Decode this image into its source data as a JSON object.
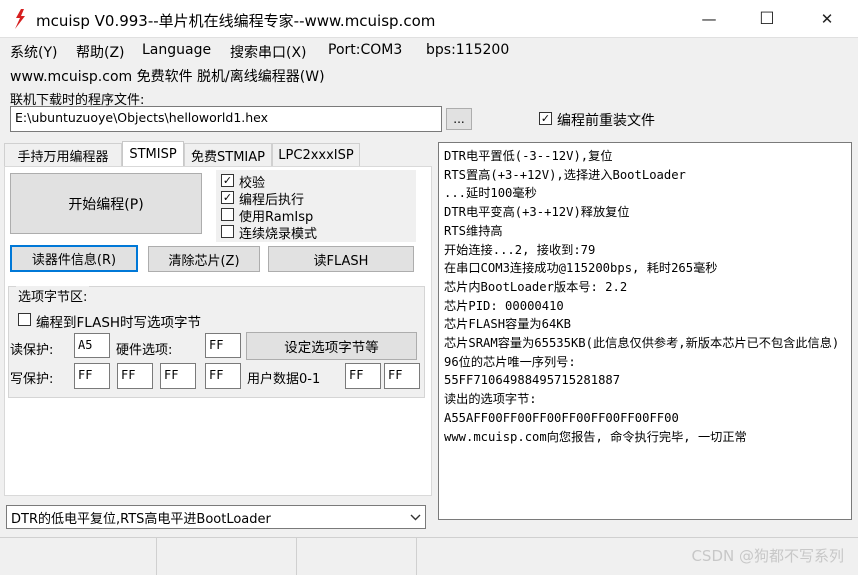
{
  "window": {
    "title": "mcuisp V0.993--单片机在线编程专家--www.mcuisp.com",
    "minimize": "—",
    "maximize": "☐",
    "close": "✕"
  },
  "menu": {
    "items": [
      "系统(Y)",
      "帮助(Z)",
      "Language",
      "搜索串口(X)",
      "Port:COM3",
      "bps:115200"
    ],
    "second_row": "www.mcuisp.com 免费软件 脱机/离线编程器(W)"
  },
  "file": {
    "label": "联机下载时的程序文件:",
    "path": "E:\\ubuntuzuoye\\Objects\\helloworld1.hex",
    "browse": "...",
    "reload_label": "编程前重装文件",
    "reload_checked": true
  },
  "tabs": [
    {
      "label": "手持万用编程器",
      "active": false
    },
    {
      "label": "STMISP",
      "active": true
    },
    {
      "label": "免费STMIAP",
      "active": false
    },
    {
      "label": "LPC2xxxISP",
      "active": false
    }
  ],
  "stmisp": {
    "start_button": "开始编程(P)",
    "options": [
      {
        "label": "校验",
        "checked": true
      },
      {
        "label": "编程后执行",
        "checked": true
      },
      {
        "label": "使用RamIsp",
        "checked": false
      },
      {
        "label": "连续烧录模式",
        "checked": false
      }
    ],
    "read_info_button": "读器件信息(R)",
    "erase_button": "清除芯片(Z)",
    "read_flash_button": "读FLASH"
  },
  "option_bytes": {
    "title": "选项字节区:",
    "write_on_flash_label": "编程到FLASH时写选项字节",
    "write_on_flash_checked": false,
    "read_protect_label": "读保护:",
    "read_protect_value": "A5",
    "hw_option_label": "硬件选项:",
    "hw_option_value": "FF",
    "set_button": "设定选项字节等",
    "write_protect_label": "写保护:",
    "write_protect_values": [
      "FF",
      "FF",
      "FF",
      "FF"
    ],
    "user_data_label": "用户数据0-1",
    "user_data_values": [
      "FF",
      "FF"
    ]
  },
  "log": {
    "lines": [
      "DTR电平置低(-3--12V),复位",
      "RTS置高(+3-+12V),选择进入BootLoader",
      "...延时100毫秒",
      "DTR电平变高(+3-+12V)释放复位",
      "RTS维持高",
      "开始连接...2, 接收到:79",
      "在串口COM3连接成功@115200bps, 耗时265毫秒",
      "芯片内BootLoader版本号: 2.2",
      "芯片PID: 00000410",
      "芯片FLASH容量为64KB",
      "芯片SRAM容量为65535KB(此信息仅供参考,新版本芯片已不包含此信息)",
      "96位的芯片唯一序列号:",
      "55FF71064988495715281887",
      "读出的选项字节:",
      "A55AFF00FF00FF00FF00FF00FF00FF00",
      "www.mcuisp.com向您报告, 命令执行完毕, 一切正常"
    ]
  },
  "mode_select": {
    "value": "DTR的低电平复位,RTS高电平进BootLoader"
  },
  "watermark": "CSDN @狗都不写系列"
}
